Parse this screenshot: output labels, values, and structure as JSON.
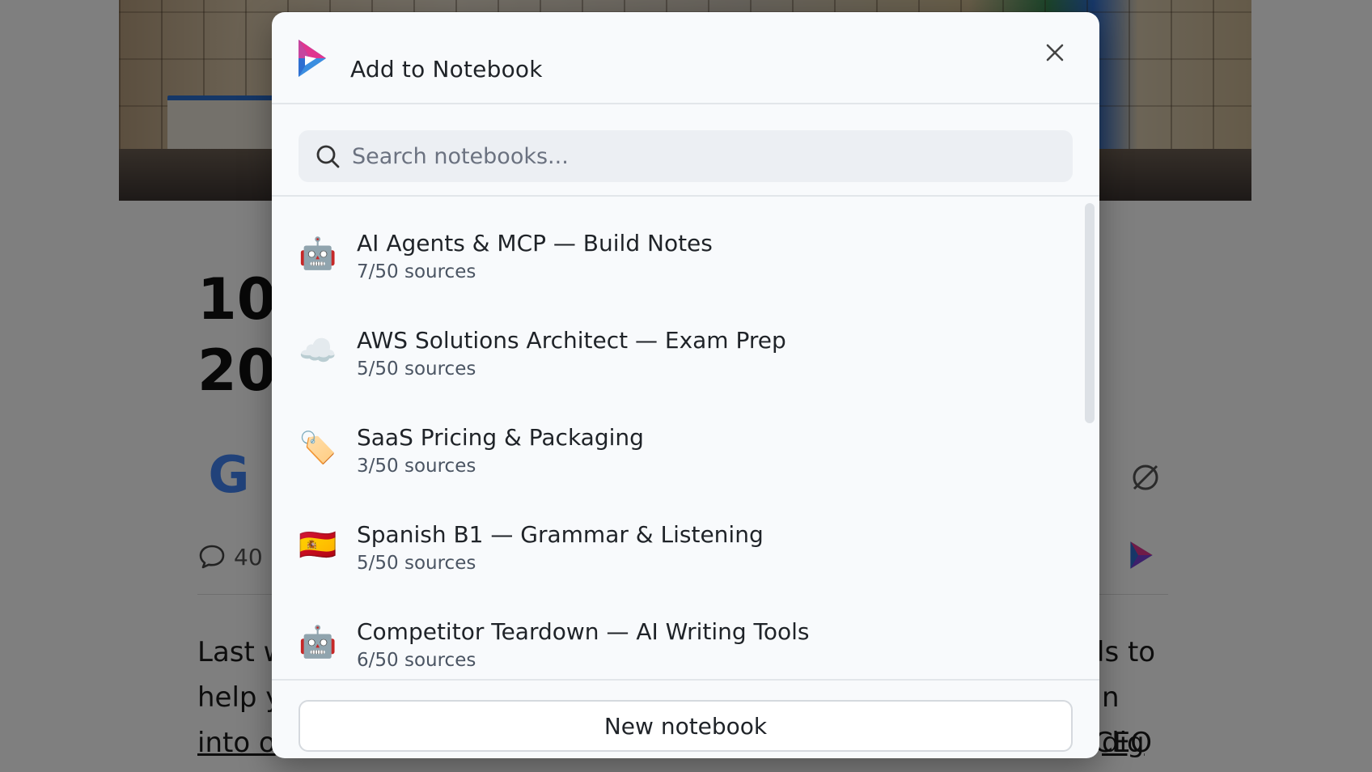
{
  "background": {
    "article_title": "100\n20",
    "comments_count": "40",
    "body_lines": [
      "Last w",
      "help y",
      "into o"
    ],
    "body_right": [
      "ls to",
      "n dig",
      "CEO"
    ],
    "link_text": "dig"
  },
  "modal": {
    "title": "Add to Notebook",
    "search": {
      "placeholder": "Search notebooks..."
    },
    "notebooks": [
      {
        "icon": "robot-icon",
        "emoji": "🤖",
        "title": "AI Agents & MCP — Build Notes",
        "sources": "7/50 sources"
      },
      {
        "icon": "cloud-icon",
        "emoji": "☁️",
        "title": "AWS Solutions Architect — Exam Prep",
        "sources": "5/50 sources"
      },
      {
        "icon": "tag-icon",
        "emoji": "🏷️",
        "title": "SaaS Pricing & Packaging",
        "sources": "3/50 sources"
      },
      {
        "icon": "spain-flag-icon",
        "emoji": "🇪🇸",
        "title": "Spanish B1 — Grammar & Listening",
        "sources": "5/50 sources"
      },
      {
        "icon": "robot-icon",
        "emoji": "🤖",
        "title": "Competitor Teardown — AI Writing Tools",
        "sources": "6/50 sources"
      }
    ],
    "new_notebook_label": "New notebook"
  },
  "colors": {
    "overlay": "#000000",
    "modal_bg": "#f8fafc",
    "brand_pink": "#e0368f",
    "brand_blue": "#2f6fd1"
  }
}
